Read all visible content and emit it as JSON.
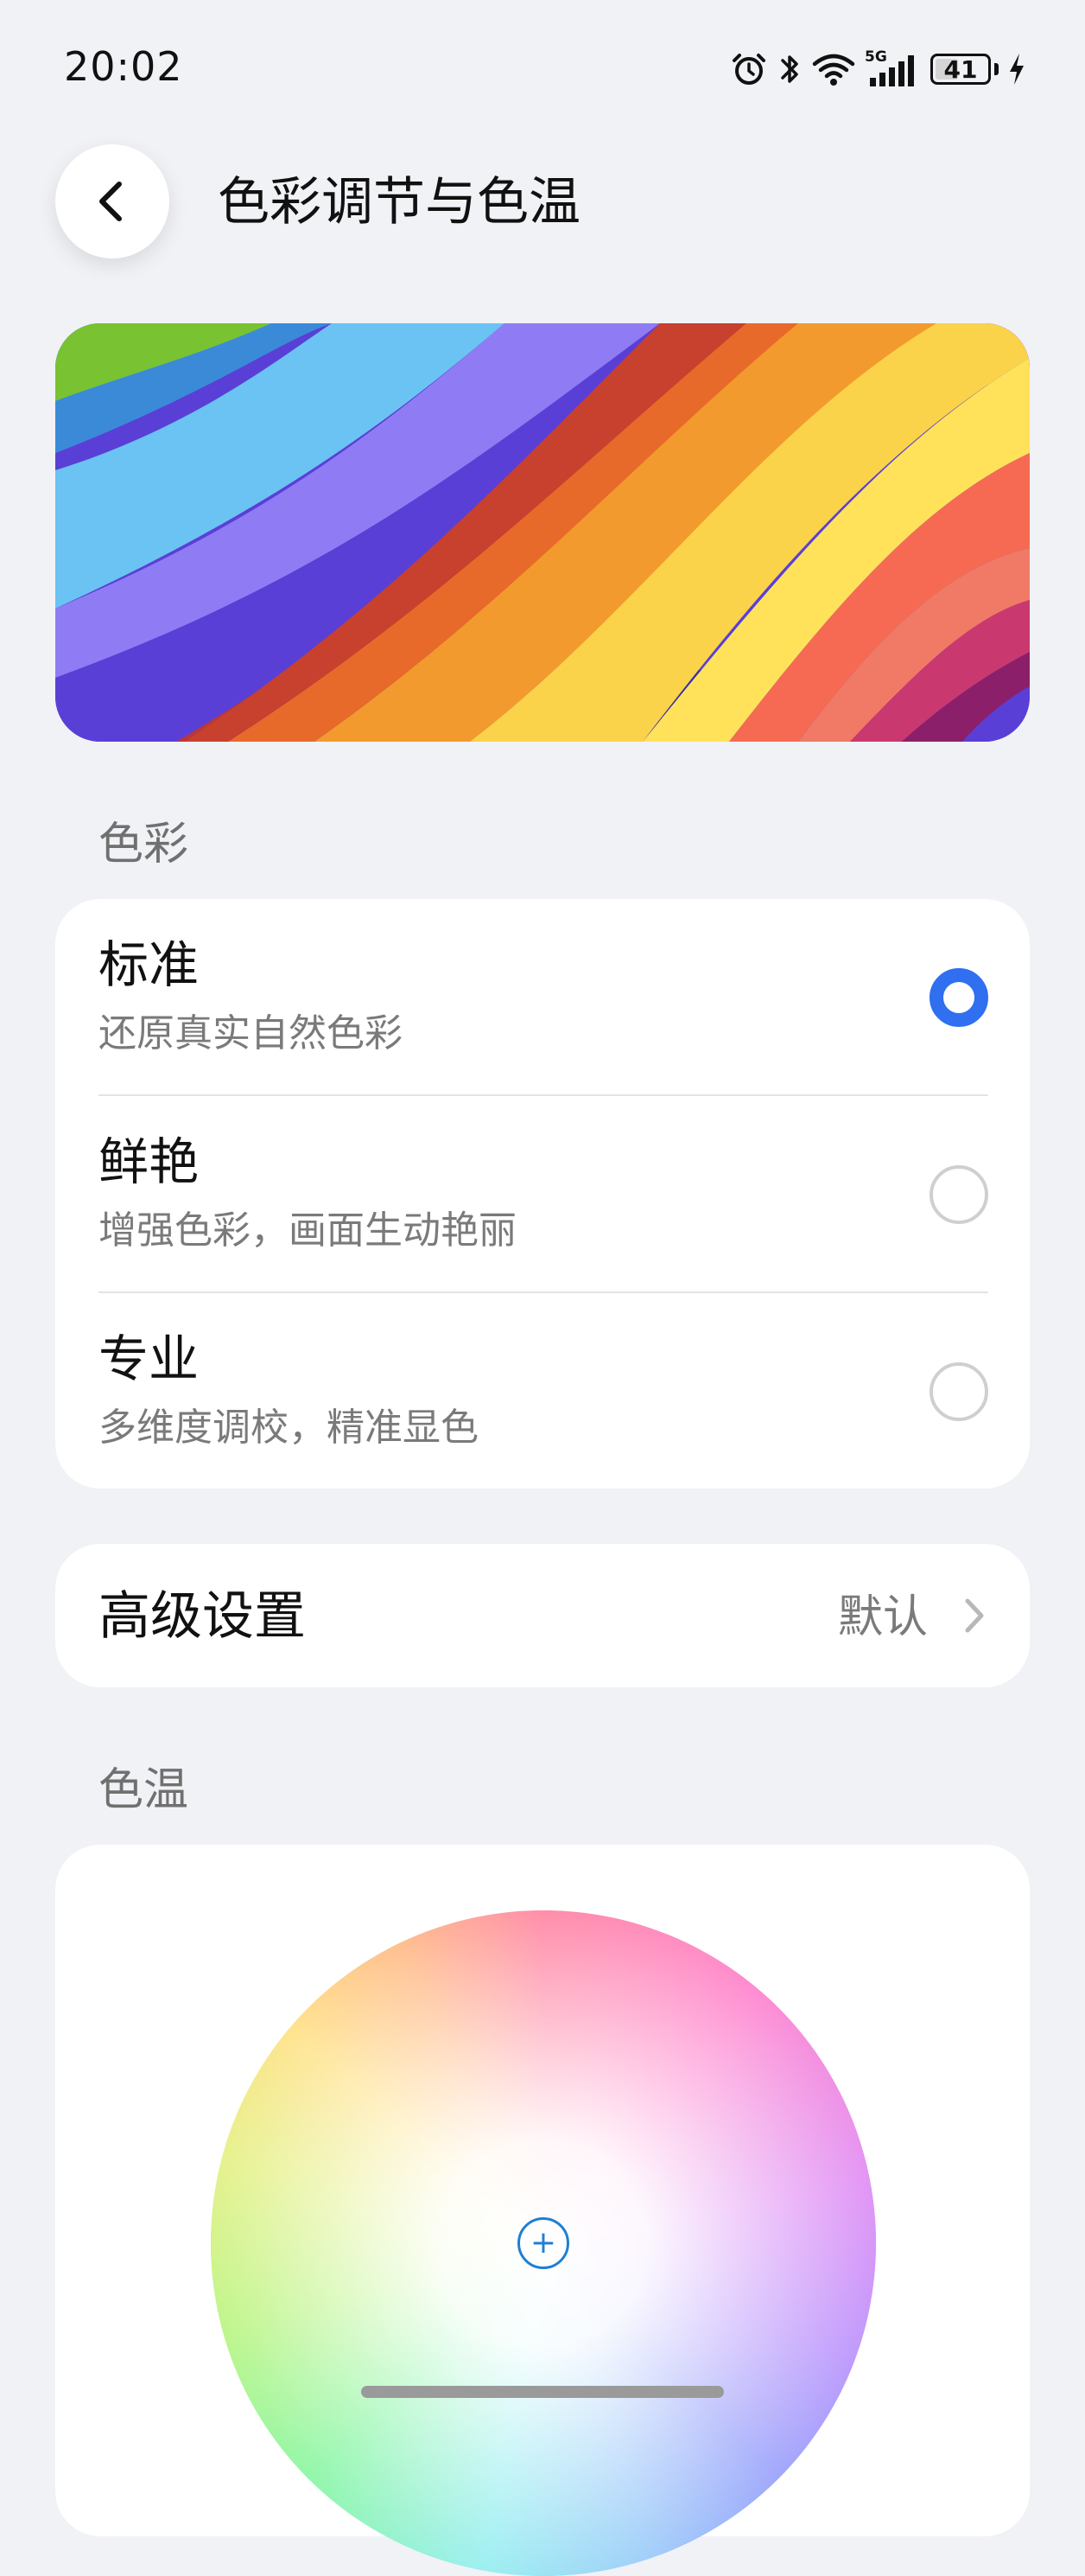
{
  "status_bar": {
    "time": "20:02",
    "network": "5G",
    "battery_level": "41"
  },
  "header": {
    "title": "色彩调节与色温",
    "back_icon": "chevron-left-icon"
  },
  "sections": {
    "color": {
      "title": "色彩",
      "options": [
        {
          "label": "标准",
          "description": "还原真实自然色彩",
          "selected": true
        },
        {
          "label": "鲜艳",
          "description": "增强色彩，画面生动艳丽",
          "selected": false
        },
        {
          "label": "专业",
          "description": "多维度调校，精准显色",
          "selected": false
        }
      ]
    },
    "advanced": {
      "label": "高级设置",
      "value": "默认"
    },
    "temperature": {
      "title": "色温"
    }
  },
  "colors": {
    "accent": "#2f6ff0",
    "background": "#f1f2f6",
    "card": "#ffffff"
  }
}
